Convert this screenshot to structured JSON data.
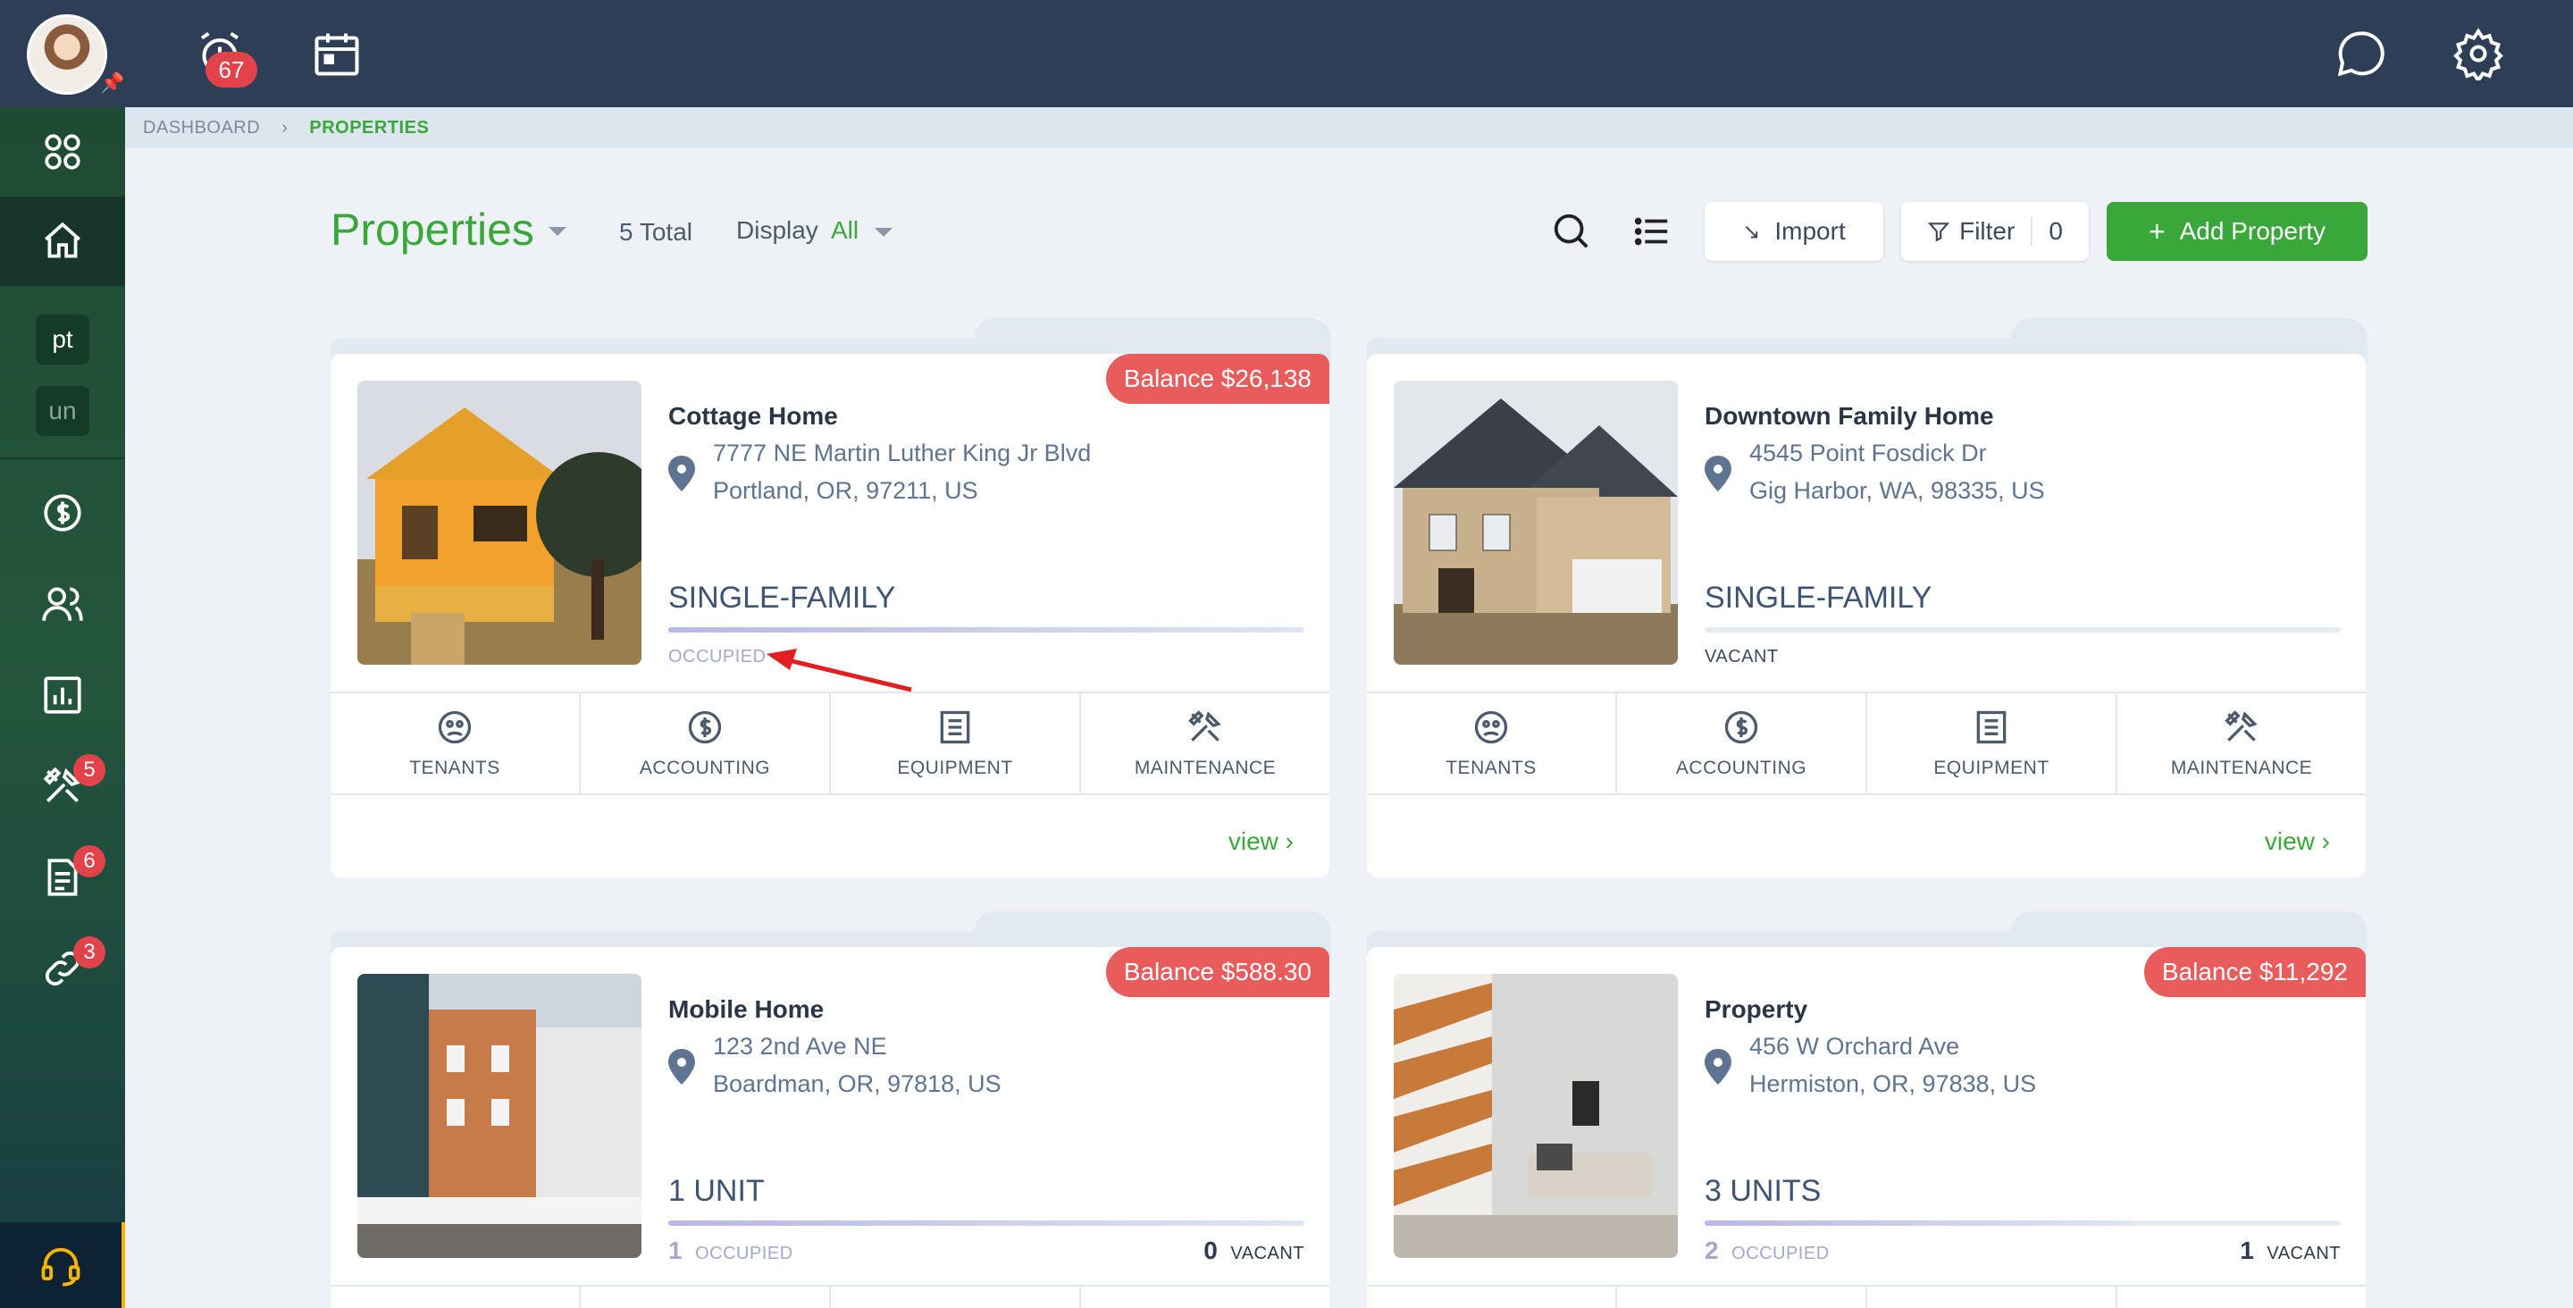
{
  "topbar": {
    "notifications_count": "67"
  },
  "sidebar": {
    "pill_pt": "pt",
    "pill_un": "un",
    "maintenance_badge": "5",
    "documents_badge": "6",
    "links_badge": "3"
  },
  "breadcrumb": {
    "dashboard": "DASHBOARD",
    "current": "PROPERTIES"
  },
  "header": {
    "title": "Properties",
    "total": "5 Total",
    "display_label": "Display",
    "display_value": "All",
    "import_label": "Import",
    "filter_label": "Filter",
    "filter_count": "0",
    "add_label": "Add Property"
  },
  "actions": {
    "tenants": "TENANTS",
    "accounting": "ACCOUNTING",
    "equipment": "EQUIPMENT",
    "maintenance": "MAINTENANCE",
    "view": "view"
  },
  "properties": [
    {
      "name": "Cottage Home",
      "address1": "7777 NE Martin Luther King Jr Blvd",
      "address2": "Portland, OR, 97211, US",
      "type": "SINGLE-FAMILY",
      "status": "OCCUPIED",
      "occupancy": 1.0,
      "balance": "Balance $26,138"
    },
    {
      "name": "Downtown Family Home",
      "address1": "4545 Point Fosdick Dr",
      "address2": "Gig Harbor, WA, 98335, US",
      "type": "SINGLE-FAMILY",
      "status": "VACANT",
      "occupancy": 0.0
    },
    {
      "name": "Mobile Home",
      "address1": "123 2nd Ave NE",
      "address2": "Boardman, OR, 97818, US",
      "type": "1 UNIT",
      "occupied_count": "1",
      "occupied_label": "OCCUPIED",
      "vacant_count": "0",
      "vacant_label": "VACANT",
      "occupancy": 1.0,
      "balance": "Balance $588.30"
    },
    {
      "name": "Property",
      "address1": "456 W Orchard Ave",
      "address2": "Hermiston, OR, 97838, US",
      "type": "3 UNITS",
      "occupied_count": "2",
      "occupied_label": "OCCUPIED",
      "vacant_count": "1",
      "vacant_label": "VACANT",
      "occupancy": 0.67,
      "balance": "Balance $11,292"
    }
  ],
  "colors": {
    "brand_green": "#3aa73a",
    "topbar": "#2f3e57",
    "balance_red": "#e85c5c",
    "badge_red": "#e2434b",
    "support_accent": "#f5b400"
  }
}
